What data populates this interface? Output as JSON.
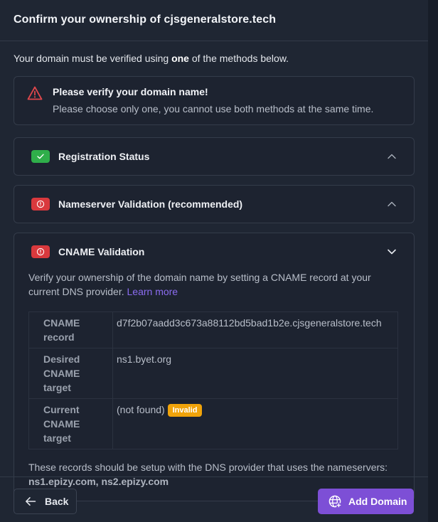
{
  "header": {
    "title": "Confirm your ownership of cjsgeneralstore.tech"
  },
  "intro": {
    "before": "Your domain must be verified using ",
    "emphasis": "one",
    "after": " of the methods below."
  },
  "alert": {
    "icon": "warning-triangle-icon",
    "title": "Please verify your domain name!",
    "text": "Please choose only one, you cannot use both methods at the same time."
  },
  "methods": [
    {
      "title": "Registration Status",
      "status": "verified",
      "badge_icon": "check-icon",
      "badge_color": "#2fae4a",
      "expanded": false
    },
    {
      "title": "Nameserver Validation (recommended)",
      "status": "error",
      "badge_icon": "alert-circle-icon",
      "badge_color": "#d9393d",
      "expanded": false
    },
    {
      "title": "CNAME Validation",
      "status": "error",
      "badge_icon": "alert-circle-icon",
      "badge_color": "#d9393d",
      "expanded": true
    }
  ],
  "cname": {
    "description": "Verify your ownership of the domain name by setting a CNAME record at your current DNS provider. ",
    "learn_more": "Learn more",
    "records": [
      {
        "label": "CNAME record",
        "value": "d7f2b07aadd3c673a88112bd5bad1b2e.cjsgeneralstore.tech"
      },
      {
        "label": "Desired CNAME target",
        "value": "ns1.byet.org"
      },
      {
        "label": "Current CNAME target",
        "value": "(not found)",
        "badge": "Invalid"
      }
    ],
    "note": "These records should be setup with the DNS provider that uses the nameservers:",
    "nameservers": "ns1.epizy.com, ns2.epizy.com"
  },
  "footer": {
    "back_label": "Back",
    "add_label": "Add Domain"
  },
  "colors": {
    "accent": "#7d4fd6",
    "link": "#8b6cf0",
    "warning": "#f0a30a",
    "danger": "#d9393d",
    "success": "#2fae4a"
  }
}
